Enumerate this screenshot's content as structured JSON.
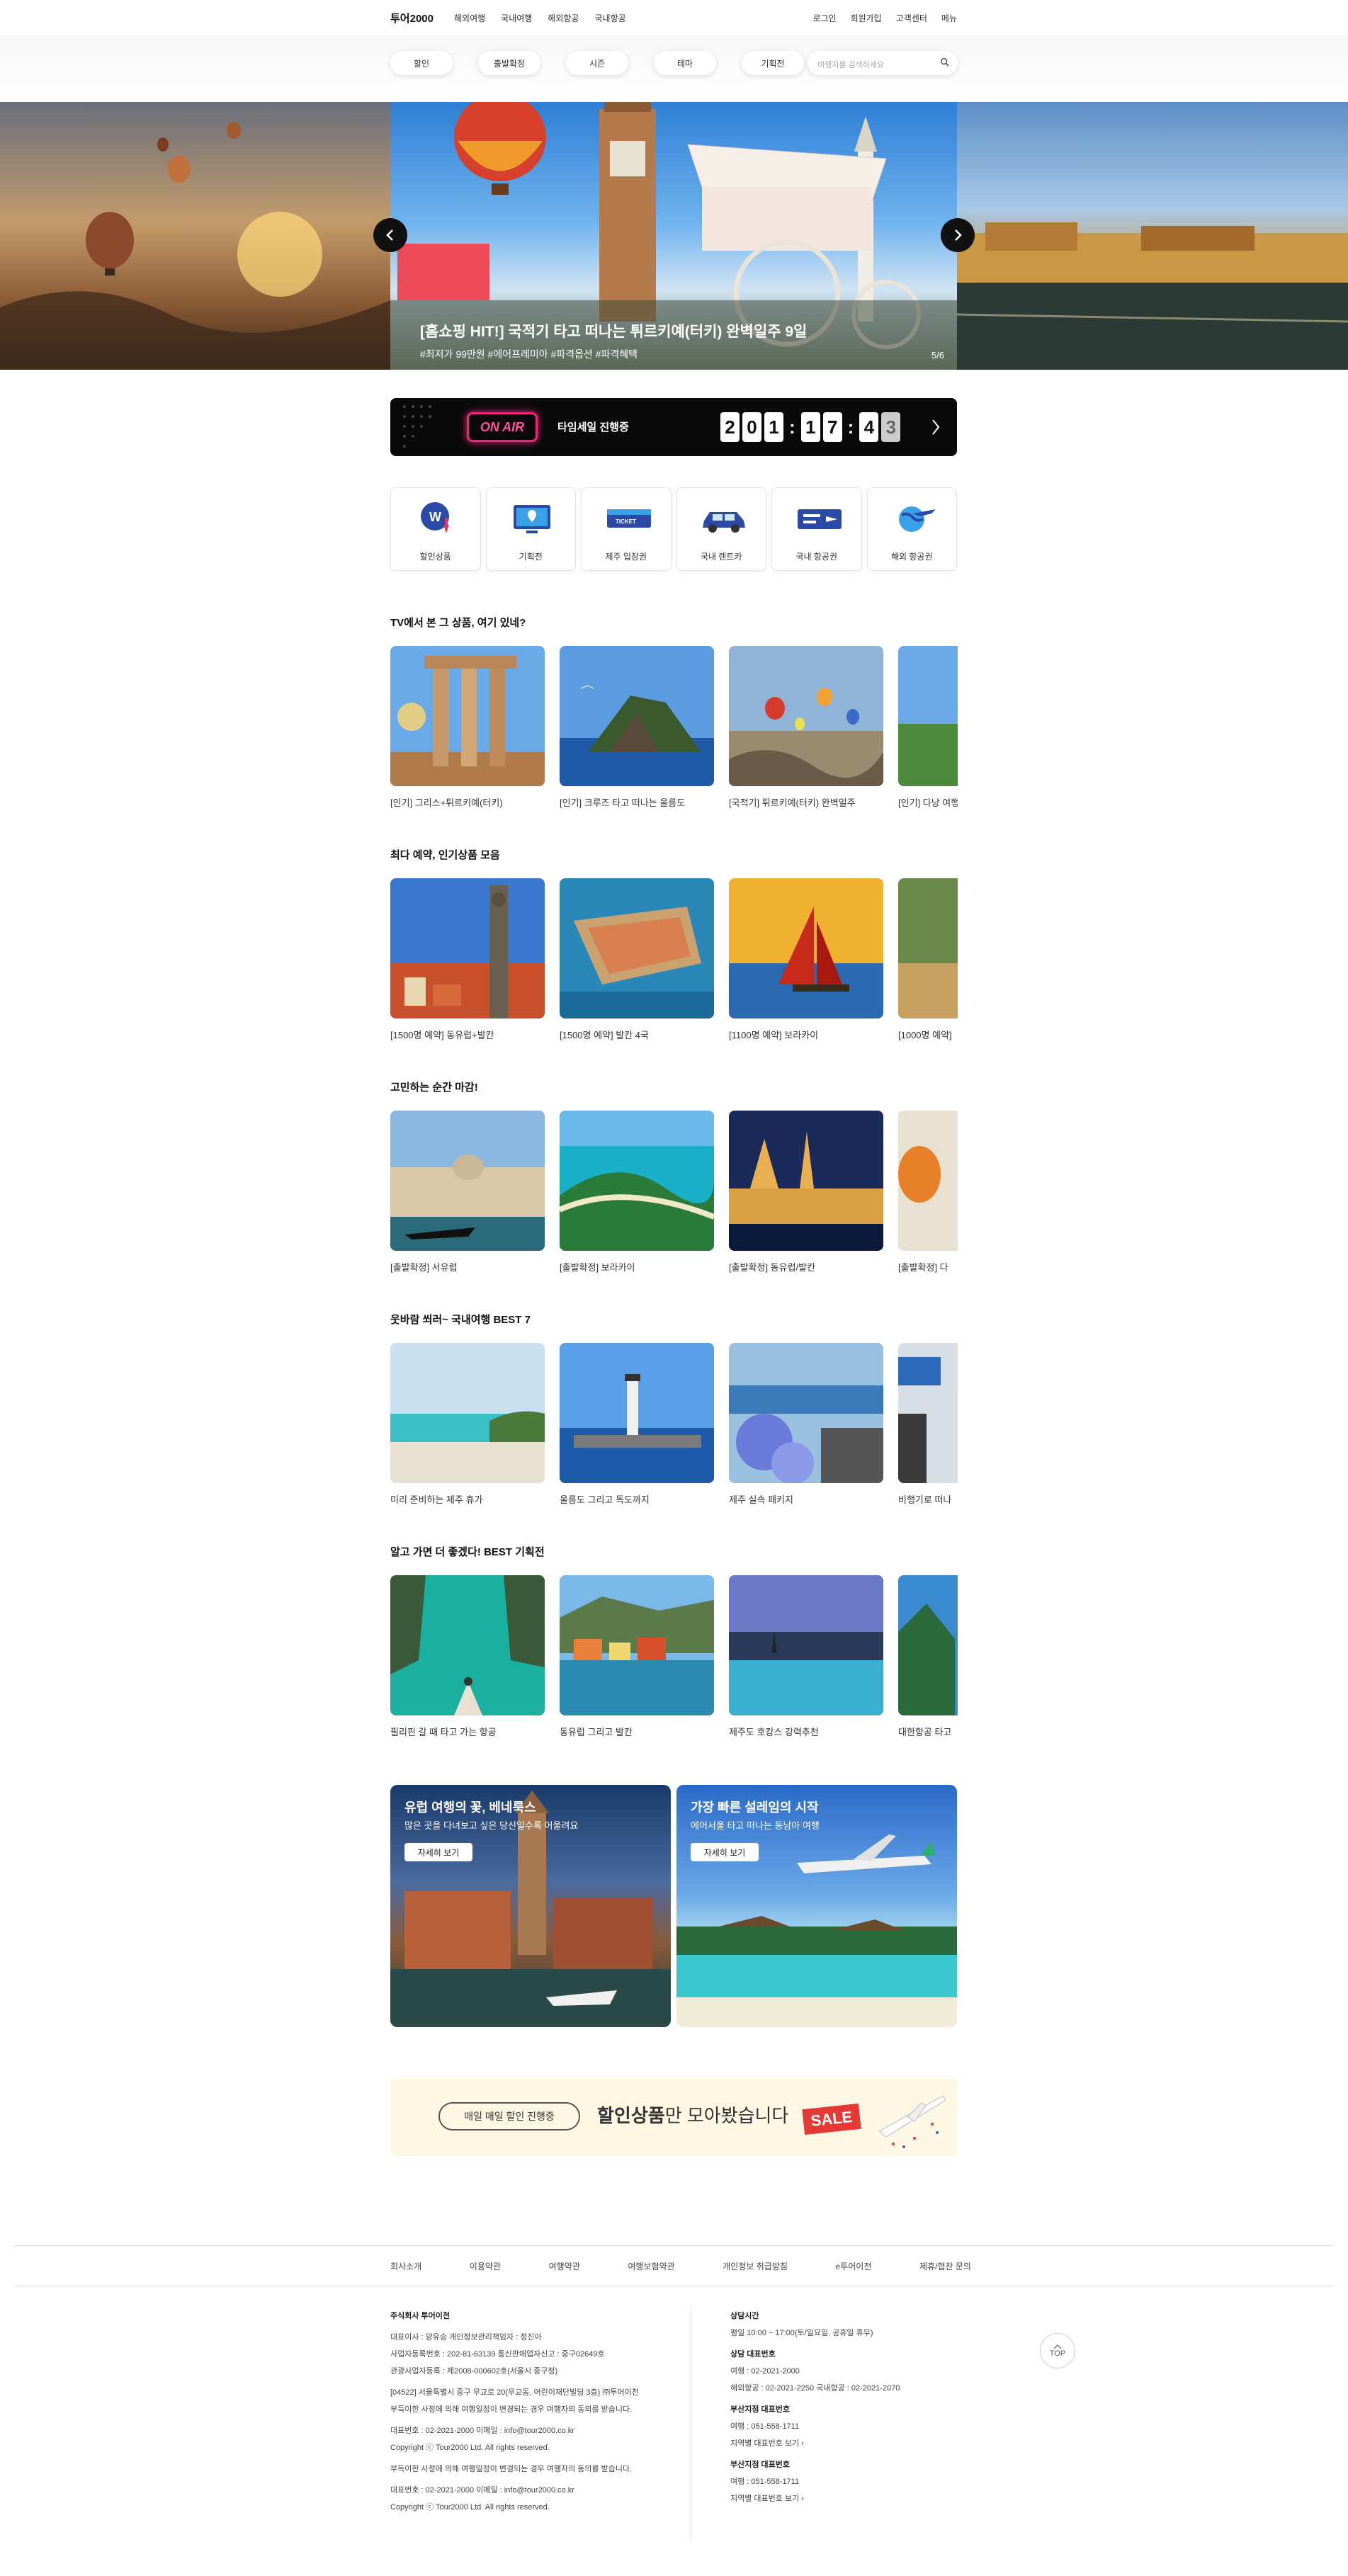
{
  "header": {
    "logo": "투어2000",
    "nav": [
      "해외여행",
      "국내여행",
      "해외항공",
      "국내항공"
    ],
    "util": [
      "로그인",
      "회원가입",
      "고객센터",
      "메뉴"
    ]
  },
  "filters": {
    "pills": [
      "할인",
      "출발확정",
      "시즌",
      "테마",
      "기획전"
    ],
    "search_placeholder": "여행지를 검색하세요"
  },
  "hero": {
    "title": "[홈쇼핑 HIT!] 국적기 타고 떠나는 튀르키예(터키) 완벽일주 9일",
    "subtitle": "#최저가 99만원 #에어프레미아 #파격옵션 #파격혜택",
    "page": "5/6"
  },
  "onair": {
    "badge": "ON AIR",
    "text": "타임세일 진행중",
    "digits": [
      "2",
      "0",
      "1",
      "1",
      "7",
      "4",
      "3"
    ]
  },
  "categories": [
    "할인상품",
    "기획전",
    "제주 입장권",
    "국내 렌트카",
    "국내 항공권",
    "해외 항공권"
  ],
  "sections": [
    {
      "title": "TV에서 본 그 상품, 여기 있네?",
      "items": [
        "[인기] 그리스+튀르키예(터키)",
        "[인기] 크루즈 타고 떠나는 울릉도",
        "[국적기] 튀르키예(터키) 완벽일주",
        "[인기] 다낭 여행"
      ]
    },
    {
      "title": "최다 예약, 인기상품 모음",
      "items": [
        "[1500명 예약] 동유럽+발칸",
        "[1500명 예약] 발칸 4국",
        "[1100명 예약] 보라카이",
        "[1000명 예약]"
      ]
    },
    {
      "title": "고민하는 순간 마감!",
      "items": [
        "[출발확정] 서유럽",
        "[출발확정] 보라카이",
        "[출발확정] 동유럽/발칸",
        "[출발확정] 다"
      ]
    },
    {
      "title": "웃바람 쐬러~ 국내여행 BEST 7",
      "items": [
        "미리 준비하는 제주 휴가",
        "울릉도 그리고 독도까지",
        "제주 실속 패키지",
        "비행기로 떠나"
      ]
    },
    {
      "title": "알고 가면 더 좋겠다! BEST 기획전",
      "items": [
        "필리핀 갈 때 타고 가는 항공",
        "동유럽 그리고 발칸",
        "제주도 호캉스 강력추천",
        "대한항공 타고"
      ]
    }
  ],
  "promos": [
    {
      "title": "유럽 여행의 꽃, 베네룩스",
      "subtitle": "많은 곳을 다녀보고 싶은 당신일수록 어울려요",
      "button": "자세히 보기"
    },
    {
      "title": "가장 빠른 설레임의 시작",
      "subtitle": "에어서울 타고 떠나는 동남아 여행",
      "button": "자세히 보기"
    }
  ],
  "sale_banner": {
    "pill": "매일 매일 할인 진행중",
    "text_bold": "할인상품",
    "text_rest": "만 모아봤습니다",
    "sale": "SALE"
  },
  "footer": {
    "nav": [
      "회사소개",
      "이용약관",
      "여행약관",
      "여행보험약관",
      "개인정보 취급방침",
      "e투어이전",
      "제휴/협찬 문의"
    ],
    "company": "주식회사 투어이천",
    "lines": [
      "대표이사 : 양유승    개인정보관리책임자 : 정진아",
      "사업자등록번호 : 202-81-63139    통신판매업자신고 : 중구02649호",
      "관광사업자등록 : 제2008-000602호(서울시 중구청)",
      "[04522] 서울특별시 중구 무교로 20(무교동, 어린이재단빌딩 3층) ㈜투어이천",
      "부득이한 사정에 의해 여행일정이 변경되는 경우 여행자의 동의를 받습니다.",
      "대표번호 : 02-2021-2000    이메일 : info@tour2000.co.kr",
      "Copyright ⓒ Tour2000 Ltd. All rights reserved.",
      "부득이한 사정에 의해 여행일정이 변경되는 경우 여행자의 동의를 받습니다.",
      "대표번호 : 02-2021-2000    이메일 : info@tour2000.co.kr",
      "Copyright ⓒ Tour2000 Ltd. All rights reserved."
    ],
    "right": {
      "hours_title": "상담시간",
      "hours": "평일 10:00 ~ 17:00(토/일요일, 공휴일 휴무)",
      "main_title": "상담 대표번호",
      "main_num": "여행 : 02-2021-2000",
      "main_air": "해외항공 : 02-2021-2250    국내항공 : 02-2021-2070",
      "busan_title": "부산지점 대표번호",
      "busan_num": "여행 : 051-558-1711",
      "busan_link": "지역별 대표번호 보기",
      "busan2_title": "부산지점 대표번호",
      "busan2_num": "여행 : 051-558-1711",
      "busan2_link": "지역별 대표번호 보기"
    },
    "top": "TOP"
  }
}
